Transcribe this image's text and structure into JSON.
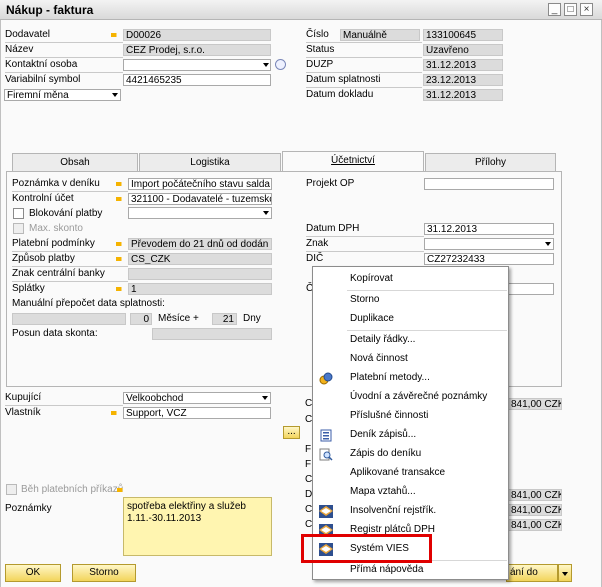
{
  "window": {
    "title": "Nákup - faktura",
    "buttons": [
      "_",
      "□",
      "×"
    ]
  },
  "header_left": {
    "dodavatel": {
      "label": "Dodavatel",
      "value": "D00026"
    },
    "nazev": {
      "label": "Název",
      "value": "ČEZ Prodej, s.r.o."
    },
    "kontaktni_osoba": {
      "label": "Kontaktní osoba",
      "value": ""
    },
    "variabilni_symbol": {
      "label": "Variabilní symbol",
      "value": "4421465235"
    },
    "mena": {
      "value": "Firemní měna"
    }
  },
  "header_right": {
    "cislo": {
      "label": "Číslo",
      "series": "Manuálně",
      "value": "133100645"
    },
    "status": {
      "label": "Status",
      "value": "Uzavřeno"
    },
    "duzp": {
      "label": "DUZP",
      "value": "31.12.2013"
    },
    "datum_splatnosti": {
      "label": "Datum splatnosti",
      "value": "23.12.2013"
    },
    "datum_dokladu": {
      "label": "Datum dokladu",
      "value": "31.12.2013"
    }
  },
  "tabs": [
    {
      "label": "Obsah"
    },
    {
      "label": "Logistika"
    },
    {
      "label": "Účetnictví"
    },
    {
      "label": "Přílohy"
    }
  ],
  "ucetnictvi": {
    "poznamka_v_deniku": {
      "label": "Poznámka v deníku",
      "value": "Import počátečního stavu salda"
    },
    "kontrolni_ucet": {
      "label": "Kontrolní účet",
      "value": "321100 - Dodavatelé - tuzemsko"
    },
    "blokovani_platby": {
      "label": "Blokování platby"
    },
    "max_skonto": {
      "label": "Max. skonto"
    },
    "platebni_podminky": {
      "label": "Platební podmínky",
      "value": "Převodem do 21 dnů od dodán"
    },
    "zpusob_platby": {
      "label": "Způsob platby",
      "value": "CS_CZK"
    },
    "znak_centralni_banky": {
      "label": "Znak centrální banky",
      "value": ""
    },
    "splatky": {
      "label": "Splátky",
      "value": "1"
    },
    "manualni_prepocet": {
      "label": "Manuální přepočet data splatnosti:",
      "v1": "0",
      "mesice": "Měsíce +",
      "v2": "21",
      "dny": "Dny"
    },
    "posun_data_skonta": {
      "label": "Posun data skonta:"
    },
    "projekt_op": {
      "label": "Projekt OP",
      "value": ""
    },
    "datum_dph": {
      "label": "Datum DPH",
      "value": "31.12.2013"
    },
    "znak": {
      "label": "Znak",
      "value": ""
    },
    "dic": {
      "label": "DIČ",
      "value": "CZ27232433"
    },
    "partial_label": "Č"
  },
  "bottom": {
    "kupujici": {
      "label": "Kupující",
      "value": "Velkoobchod"
    },
    "vlastnik": {
      "label": "Vlastník",
      "value": "Support, VCZ"
    },
    "ellipsis": "...",
    "beh_platebnich_prikazu": {
      "label": "Běh platebních příkazů"
    },
    "poznamky": {
      "label": "Poznámky",
      "value": "spotřeba elektřiny a služeb 1.11.-30.11.2013"
    },
    "right_letters": [
      "C",
      "C",
      "F",
      "F",
      "C",
      "D",
      "C",
      "C"
    ],
    "amounts": [
      "841,00 CZK",
      "841,00 CZK",
      "841,00 CZK",
      "841,00 CZK"
    ]
  },
  "buttons": {
    "ok": "OK",
    "storno": "Storno",
    "right_partial": "ání do"
  },
  "context_menu": {
    "items": [
      {
        "label": "Kopírovat",
        "icon": "none"
      },
      {
        "label": "Storno",
        "icon": "none"
      },
      {
        "label": "Duplikace",
        "icon": "none"
      },
      {
        "label": "Detaily řádky...",
        "icon": "none"
      },
      {
        "label": "Nová činnost",
        "icon": "none"
      },
      {
        "label": "Platební metody...",
        "icon": "coins-icon"
      },
      {
        "label": "Úvodní a závěrečné poznámky",
        "icon": "none"
      },
      {
        "label": "Příslušné činnosti",
        "icon": "none"
      },
      {
        "label": "Deník zápisů...",
        "icon": "journal-icon"
      },
      {
        "label": "Zápis do deníku",
        "icon": "magnifier-icon"
      },
      {
        "label": "Aplikované transakce",
        "icon": "none"
      },
      {
        "label": "Mapa vztahů...",
        "icon": "none"
      },
      {
        "label": "Insolvenční rejstřík.",
        "icon": "vies-icon"
      },
      {
        "label": "Registr plátců DPH",
        "icon": "vies-icon"
      },
      {
        "label": "Systém VIES",
        "icon": "vies-icon"
      },
      {
        "label": "Přímá nápověda",
        "icon": "none"
      }
    ]
  },
  "colors": {
    "highlight": "#e00000",
    "field_yellow": "#fff5b0",
    "link_arrow": "#f5b300"
  }
}
